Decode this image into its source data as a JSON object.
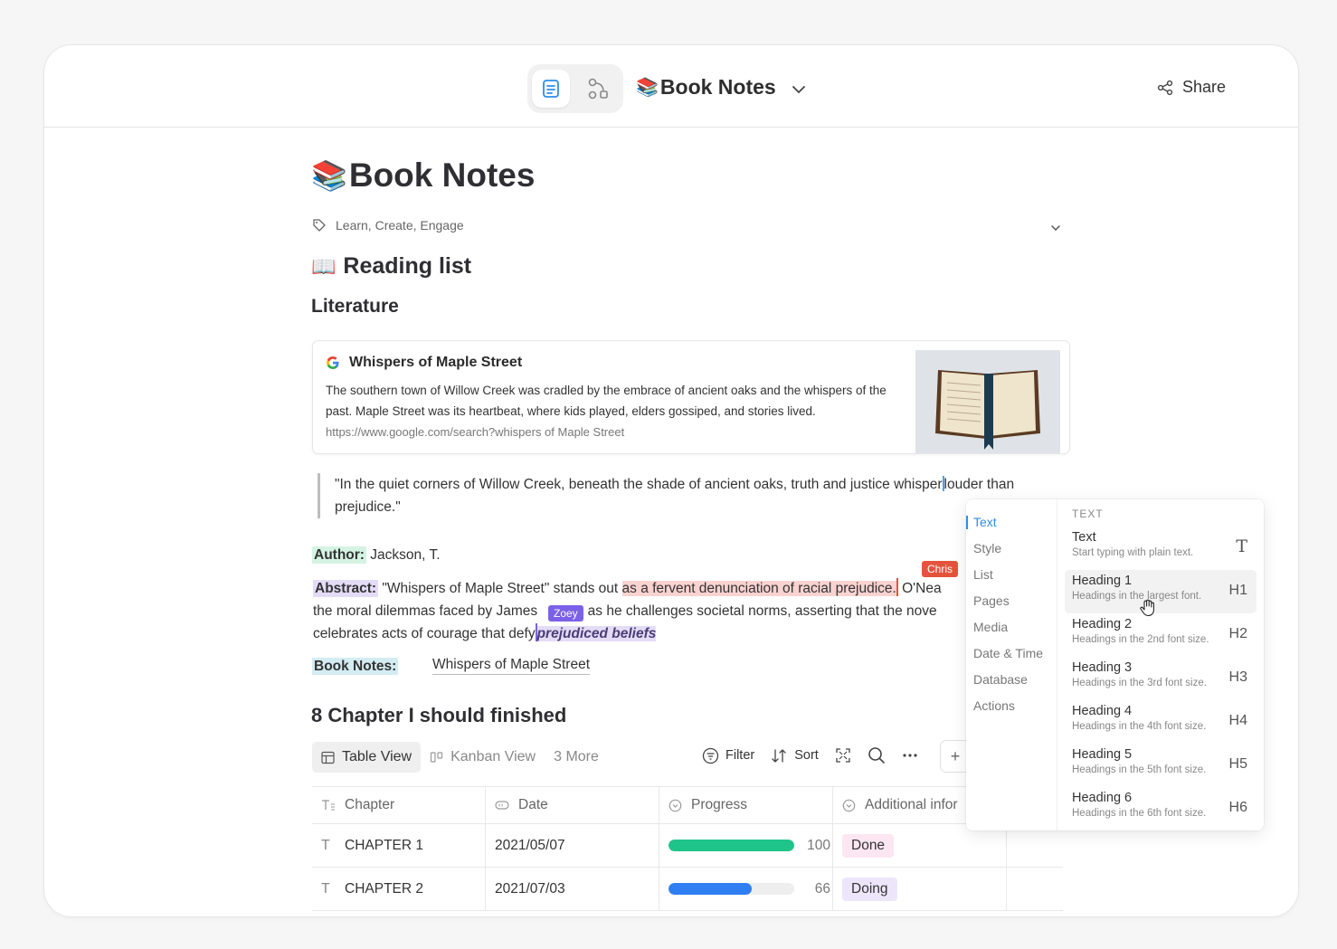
{
  "header": {
    "doc_title": "Book Notes",
    "share_label": "Share",
    "doc_emoji": "📚"
  },
  "page": {
    "title": "Book Notes",
    "tags": "Learn, Create, Engage",
    "reading_list_heading": "Reading list",
    "reading_list_emoji": "📖",
    "literature_heading": "Literature"
  },
  "link_card": {
    "title": "Whispers of Maple Street",
    "description": "The southern town of Willow Creek was cradled by the embrace of ancient oaks and the whispers of the past. Maple Street was its heartbeat, where kids played, elders gossiped, and stories lived.",
    "url": "https://www.google.com/search?whispers of Maple Street"
  },
  "quote": {
    "before_caret": "\"In the quiet corners of Willow Creek, beneath the shade of ancient oaks, truth and justice whisper",
    "after_caret": "louder than prejudice.\""
  },
  "fields": {
    "author_label": "Author:",
    "author_value": " Jackson, T.",
    "abstract_label": "Abstract:",
    "abstract_part1": " \"Whispers of Maple Street\" stands out ",
    "abstract_highlight": "as a fervent denunciation of racial prejudice.",
    "abstract_part2": " O'Nea",
    "abstract_line2a": "the moral dilemmas faced by James",
    "abstract_line2b": "on as he challenges societal norms, asserting that the nove",
    "abstract_line3": "celebrates acts of courage that defy",
    "abstract_highlight2": "prejudiced beliefs",
    "book_notes_label": "Book Notes:",
    "book_notes_value": "Whispers of Maple Street"
  },
  "collaborators": {
    "chris": "Chris",
    "zoey": "Zoey"
  },
  "database": {
    "heading": "8 Chapter I should finished",
    "views": [
      "Table View",
      "Kanban View",
      "3 More"
    ],
    "toolbar": {
      "filter": "Filter",
      "sort": "Sort"
    },
    "columns": [
      "Chapter",
      "Date",
      "Progress",
      "Additional infor"
    ],
    "rows": [
      {
        "chapter": "CHAPTER 1",
        "date": "2021/05/07",
        "progress": 100,
        "progress_label": "100",
        "color": "#1fc48a",
        "status": "Done"
      },
      {
        "chapter": "CHAPTER 2",
        "date": "2021/07/03",
        "progress": 66,
        "progress_label": "66",
        "color": "#2f7ff2",
        "status": "Doing"
      }
    ]
  },
  "slash_menu": {
    "categories": [
      "Text",
      "Style",
      "List",
      "Pages",
      "Media",
      "Date & Time",
      "Database",
      "Actions"
    ],
    "section_label": "TEXT",
    "items": [
      {
        "title": "Text",
        "sub": "Start typing with plain text.",
        "key": "T"
      },
      {
        "title": "Heading 1",
        "sub": "Headings in the largest font.",
        "key": "H1"
      },
      {
        "title": "Heading 2",
        "sub": "Headings in the 2nd font size.",
        "key": "H2"
      },
      {
        "title": "Heading 3",
        "sub": "Headings in the 3rd font size.",
        "key": "H3"
      },
      {
        "title": "Heading 4",
        "sub": "Headings in the 4th font size.",
        "key": "H4"
      },
      {
        "title": "Heading 5",
        "sub": "Headings in the 5th font size.",
        "key": "H5"
      },
      {
        "title": "Heading 6",
        "sub": "Headings in the 6th font size.",
        "key": "H6"
      }
    ]
  }
}
